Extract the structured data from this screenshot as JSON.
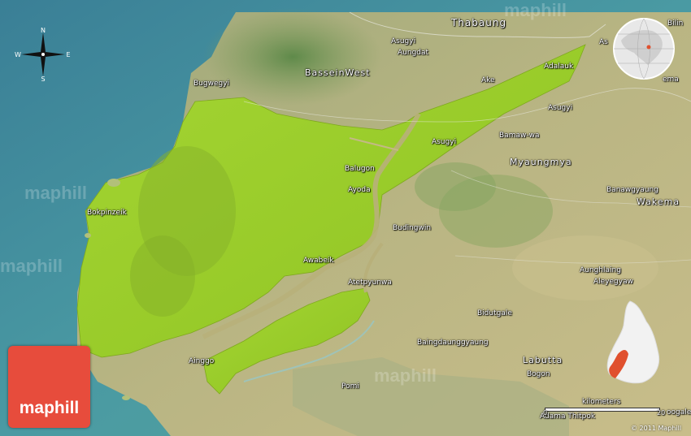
{
  "brand": {
    "logo_text": "maphill",
    "watermark": "maphill",
    "copyright": "© 2011 Maphill"
  },
  "compass": {
    "n": "N",
    "s": "S",
    "e": "E",
    "w": "W"
  },
  "scale": {
    "label": "kilometers",
    "left_value": "0",
    "right_value": "20"
  },
  "colors": {
    "highlight": "#9ccf2a",
    "sea": "#3d8fa0",
    "logo": "#e74c3c",
    "inset_highlight": "#e0502e"
  },
  "regions": {
    "bassein_west": "BasseinWest",
    "myaungmya": "Myaungmya",
    "labutta": "Labutta",
    "thabaung": "Thabaung"
  },
  "places": {
    "bilin": "Bilin",
    "asugyi_n": "Asugyi",
    "aungdat": "Aungdat",
    "as_partial": "As",
    "adalauk": "Adalauk",
    "bugwegyi": "Bugwegyi",
    "ake": "Ake",
    "asugyi_e": "Asugyi",
    "asugyi_c": "Asugyi",
    "bamaw_wa": "Bamaw-wa",
    "ema_partial": "ema",
    "balugon": "Balugon",
    "ayoda": "Ayoda",
    "banawgyaung": "Banawgyaung",
    "wakema": "Wakema",
    "bokpinzeik": "Bokpinzeik",
    "budingwin": "Budingwin",
    "awabeik": "Awabeik",
    "atetpyunwa": "Atetpyunwa",
    "aunghlaing": "Aunghlaing",
    "aleyegyaw": "Aleyegyaw",
    "bidutgale": "Bidutgale",
    "baingdaunggyaung": "Baingdaunggyaung",
    "ainggo": "Ainggo",
    "bogon": "Bogon",
    "pomi": "Pomi",
    "adama_thitpok": "Adama Thitpok",
    "doogale": "oogale"
  }
}
